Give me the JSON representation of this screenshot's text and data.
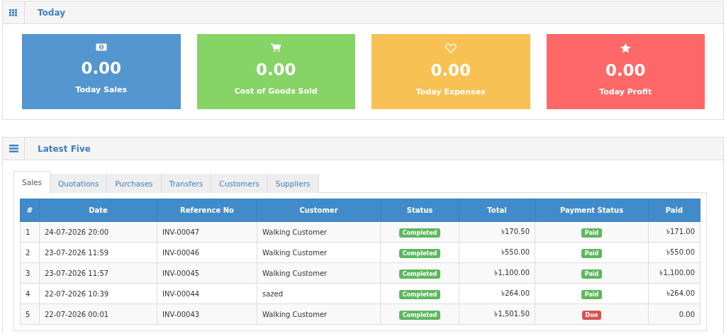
{
  "today": {
    "title": "Today",
    "cards": [
      {
        "kind": "money",
        "color": "#5496cf",
        "value": "0.00",
        "label": "Today Sales"
      },
      {
        "kind": "cart",
        "color": "#86d366",
        "value": "0.00",
        "label": "Cost of Goods Sold"
      },
      {
        "kind": "heart",
        "color": "#f8c153",
        "value": "0.00",
        "label": "Today Expenses"
      },
      {
        "kind": "star",
        "color": "#fe6868",
        "value": "0.00",
        "label": "Today Profit"
      }
    ]
  },
  "latest": {
    "title": "Latest Five",
    "tabs": [
      {
        "label": "Sales",
        "selected": true
      },
      {
        "label": "Quotations",
        "selected": false
      },
      {
        "label": "Purchases",
        "selected": false
      },
      {
        "label": "Transfers",
        "selected": false
      },
      {
        "label": "Customers",
        "selected": false
      },
      {
        "label": "Suppliers",
        "selected": false
      }
    ],
    "table": {
      "columns": [
        "#",
        "Date",
        "Reference No",
        "Customer",
        "Status",
        "Total",
        "Payment Status",
        "Paid"
      ],
      "rows": [
        {
          "num": "1",
          "date": "24-07-2026 20:00",
          "ref": "INV-00047",
          "customer": "Walking Customer",
          "status": {
            "text": "Completed",
            "color": "#5cb85c"
          },
          "total": "৳170.50",
          "payment": {
            "text": "Paid",
            "color": "#5cb85c"
          },
          "paid": "৳171.00"
        },
        {
          "num": "2",
          "date": "23-07-2026 11:59",
          "ref": "INV-00046",
          "customer": "Walking Customer",
          "status": {
            "text": "Completed",
            "color": "#5cb85c"
          },
          "total": "৳550.00",
          "payment": {
            "text": "Paid",
            "color": "#5cb85c"
          },
          "paid": "৳550.00"
        },
        {
          "num": "3",
          "date": "23-07-2026 11:57",
          "ref": "INV-00045",
          "customer": "Walking Customer",
          "status": {
            "text": "Completed",
            "color": "#5cb85c"
          },
          "total": "৳1,100.00",
          "payment": {
            "text": "Paid",
            "color": "#5cb85c"
          },
          "paid": "৳1,100.00"
        },
        {
          "num": "4",
          "date": "22-07-2026 10:39",
          "ref": "INV-00044",
          "customer": "sazed",
          "status": {
            "text": "Completed",
            "color": "#5cb85c"
          },
          "total": "৳264.00",
          "payment": {
            "text": "Paid",
            "color": "#5cb85c"
          },
          "paid": "৳264.00"
        },
        {
          "num": "5",
          "date": "22-07-2026 00:01",
          "ref": "INV-00043",
          "customer": "Walking Customer",
          "status": {
            "text": "Completed",
            "color": "#5cb85c"
          },
          "total": "৳1,501.50",
          "payment": {
            "text": "Due",
            "color": "#d9534f"
          },
          "paid": "0.00"
        }
      ]
    }
  }
}
